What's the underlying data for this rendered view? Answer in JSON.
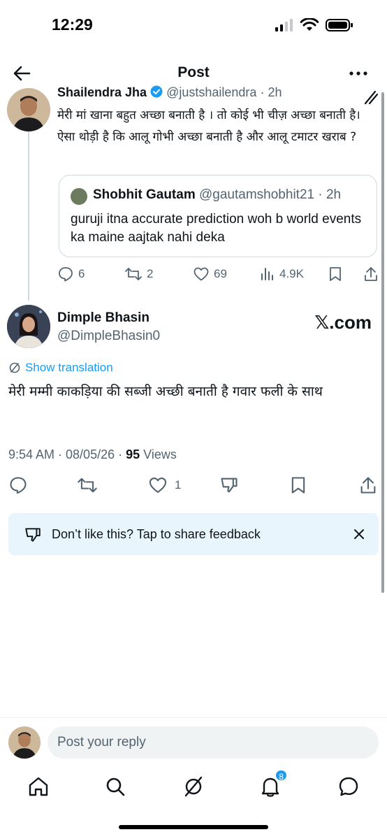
{
  "status_bar": {
    "time": "12:29"
  },
  "nav": {
    "title": "Post"
  },
  "quoted_post": {
    "name": "Shailendra Jha",
    "handle": "@justshailendra",
    "time": "2h",
    "text": "मेरी मां खाना बहुत अच्छा बनाती है । तो कोई भी चीज़ अच्छा बनाती है। ऐसा थोड़ी है कि आलू गोभी अच्छा बनाती है और आलू टमाटर खराब ?",
    "quote": {
      "name": "Shobhit Gautam",
      "handle": "@gautamshobhit21",
      "time": "2h",
      "text": "guruji itna accurate prediction woh b world events ka maine aajtak nahi deka"
    },
    "actions": {
      "replies": "6",
      "reposts": "2",
      "likes": "69",
      "views": "4.9K"
    }
  },
  "main_post": {
    "name": "Dimple Bhasin",
    "handle": "@DimpleBhasin0",
    "watermark": "𝕏.com",
    "translate_label": "Show translation",
    "text": "मेरी मम्मी काकड़िया की सब्जी अच्छी बनाती है गवार फली के साथ",
    "timestamp": "9:54 AM · 08/05/26 · ",
    "views_count": "95",
    "views_label": " Views",
    "actions": {
      "likes": "1"
    }
  },
  "feedback": {
    "text": "Don’t like this? Tap to share feedback"
  },
  "reply": {
    "placeholder": "Post your reply"
  },
  "tab_bar": {
    "notifications_badge": "8"
  },
  "colors": {
    "accent": "#1d9bf0",
    "muted": "#536471",
    "text": "#0f1419",
    "feedback_bg": "#e8f5fd"
  }
}
